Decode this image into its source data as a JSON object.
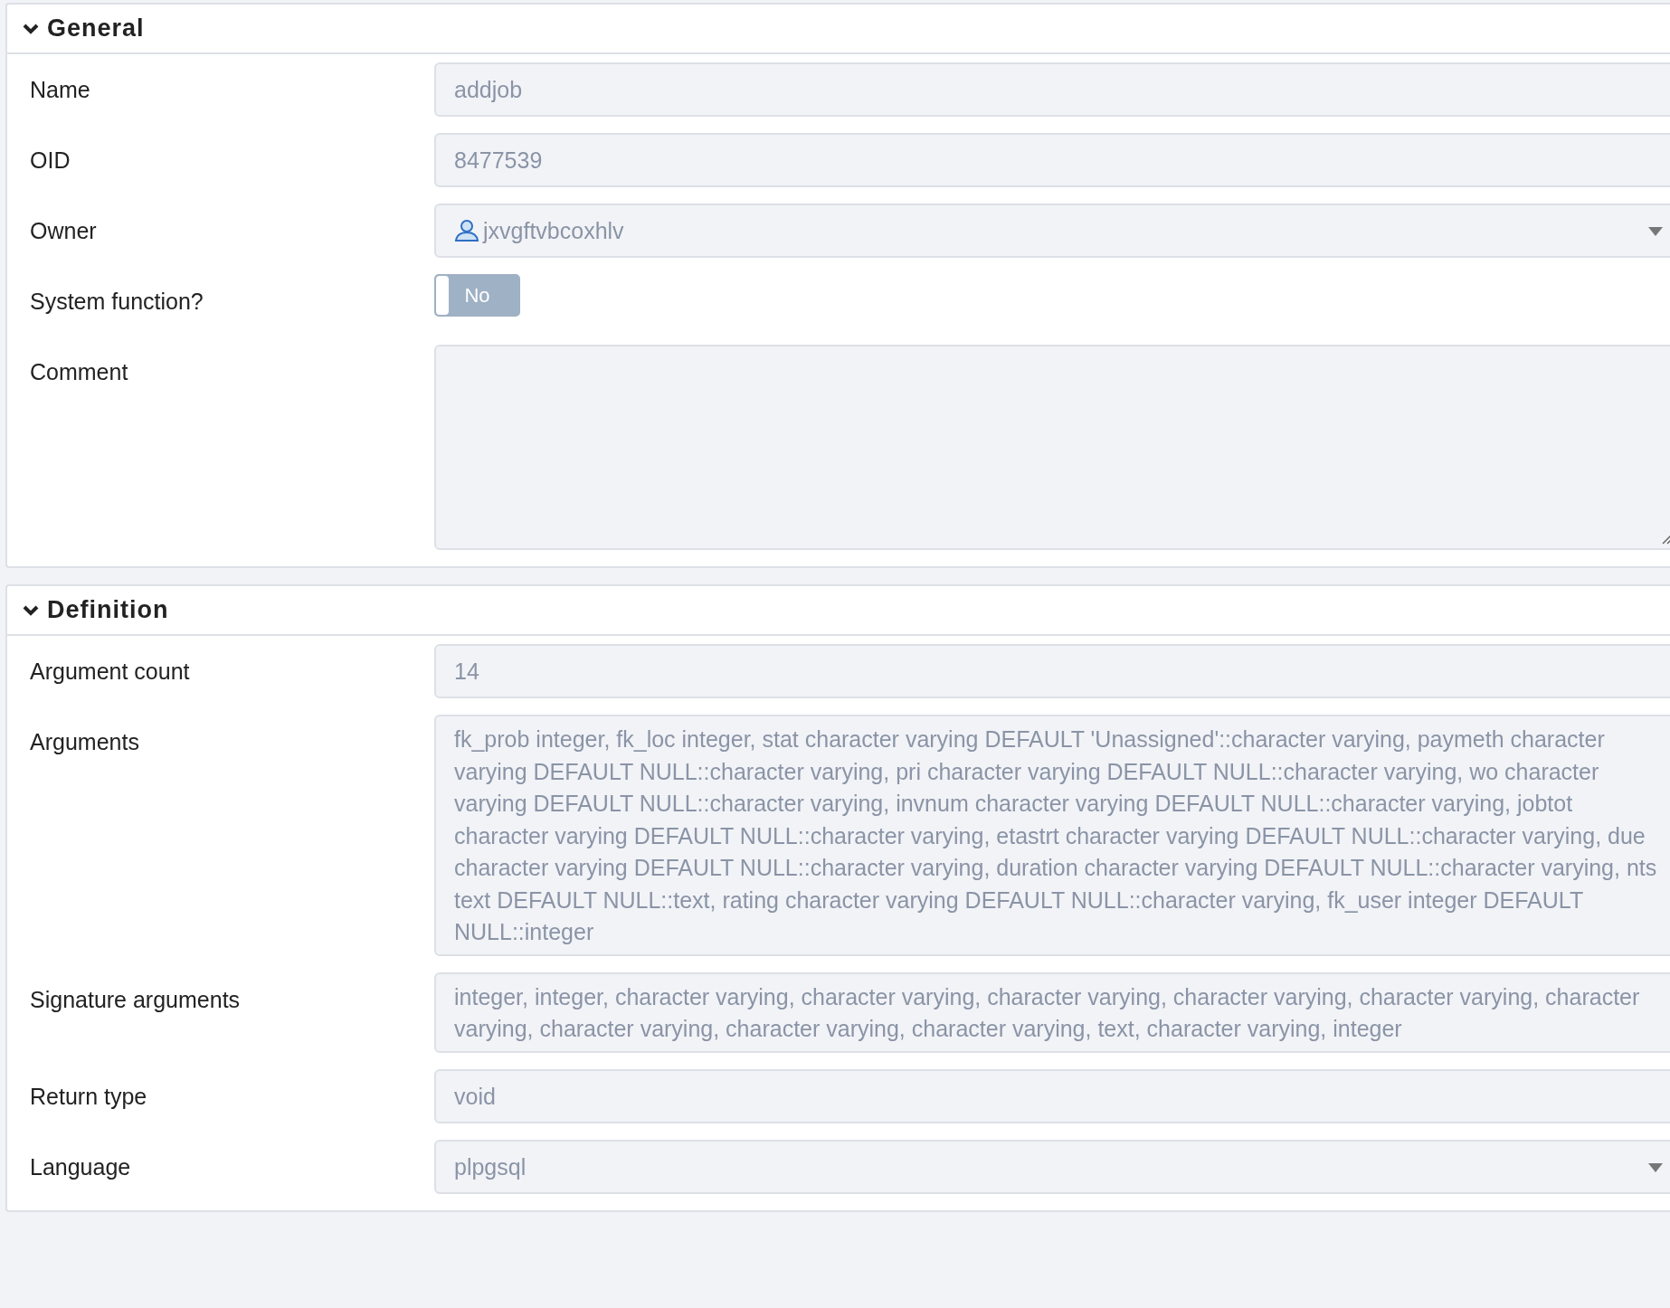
{
  "sections": [
    {
      "title": "General",
      "expanded": true,
      "fields": [
        {
          "label": "Name",
          "kind": "text",
          "value": "addjob"
        },
        {
          "label": "OID",
          "kind": "text",
          "value": "8477539"
        },
        {
          "label": "Owner",
          "kind": "user-select",
          "value": "jxvgftvbcoxhlv"
        },
        {
          "label": "System function?",
          "kind": "toggle",
          "on": false,
          "value": "No"
        },
        {
          "label": "Comment",
          "kind": "textarea"
        }
      ]
    },
    {
      "title": "Definition",
      "expanded": true,
      "fields": [
        {
          "label": "Argument count",
          "kind": "text",
          "value": "14"
        },
        {
          "label": "Arguments",
          "kind": "multiline",
          "value": "fk_prob integer, fk_loc integer, stat character varying DEFAULT 'Unassigned'::character varying, paymeth character varying DEFAULT NULL::character varying, pri character varying DEFAULT NULL::character varying, wo character varying DEFAULT NULL::character varying, invnum character varying DEFAULT NULL::character varying, jobtot character varying DEFAULT NULL::character varying, etastrt character varying DEFAULT NULL::character varying, due character varying DEFAULT NULL::character varying, duration character varying DEFAULT NULL::character varying, nts text DEFAULT NULL::text, rating character varying DEFAULT NULL::character varying, fk_user integer DEFAULT NULL::integer"
        },
        {
          "label": "Signature arguments",
          "kind": "multiline",
          "value": "integer, integer, character varying, character varying, character varying, character varying, character varying, character varying, character varying, character varying, character varying, text, character varying, integer"
        },
        {
          "label": "Return type",
          "kind": "text",
          "value": "void"
        },
        {
          "label": "Language",
          "kind": "select",
          "value": "plpgsql"
        }
      ]
    }
  ]
}
